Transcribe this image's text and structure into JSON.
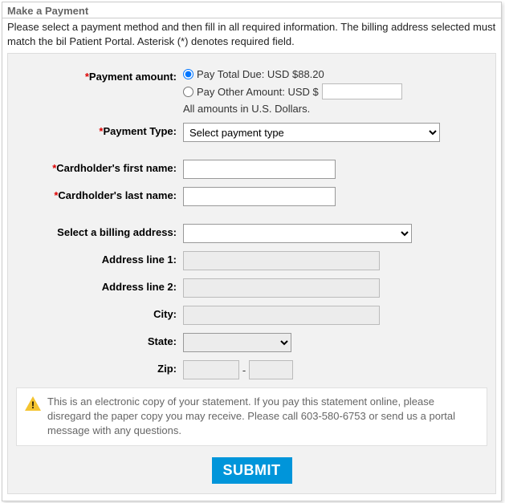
{
  "title": "Make a Payment",
  "intro": "Please select a payment method and then fill in all required information. The billing address selected must match the bil Patient Portal. Asterisk (*) denotes required field.",
  "form": {
    "payment_amount": {
      "label": "Payment amount:",
      "pay_total_label": "Pay Total Due: USD $88.20",
      "pay_other_label": "Pay Other Amount: USD $",
      "other_value": "",
      "hint": "All amounts in U.S. Dollars."
    },
    "payment_type": {
      "label": "Payment Type:",
      "placeholder": "Select payment type"
    },
    "first_name": {
      "label": "Cardholder's first name:",
      "value": ""
    },
    "last_name": {
      "label": "Cardholder's last name:",
      "value": ""
    },
    "billing_address_select": {
      "label": "Select a billing address:",
      "value": ""
    },
    "address1": {
      "label": "Address line 1:",
      "value": ""
    },
    "address2": {
      "label": "Address line 2:",
      "value": ""
    },
    "city": {
      "label": "City:",
      "value": ""
    },
    "state": {
      "label": "State:",
      "value": ""
    },
    "zip": {
      "label": "Zip:",
      "value_a": "",
      "sep": "-",
      "value_b": ""
    }
  },
  "notice": "This is an electronic copy of your statement. If you pay this statement online, please disregard the paper copy you may receive. Please call 603-580-6753 or send us a portal message with any questions.",
  "submit_label": "SUBMIT"
}
